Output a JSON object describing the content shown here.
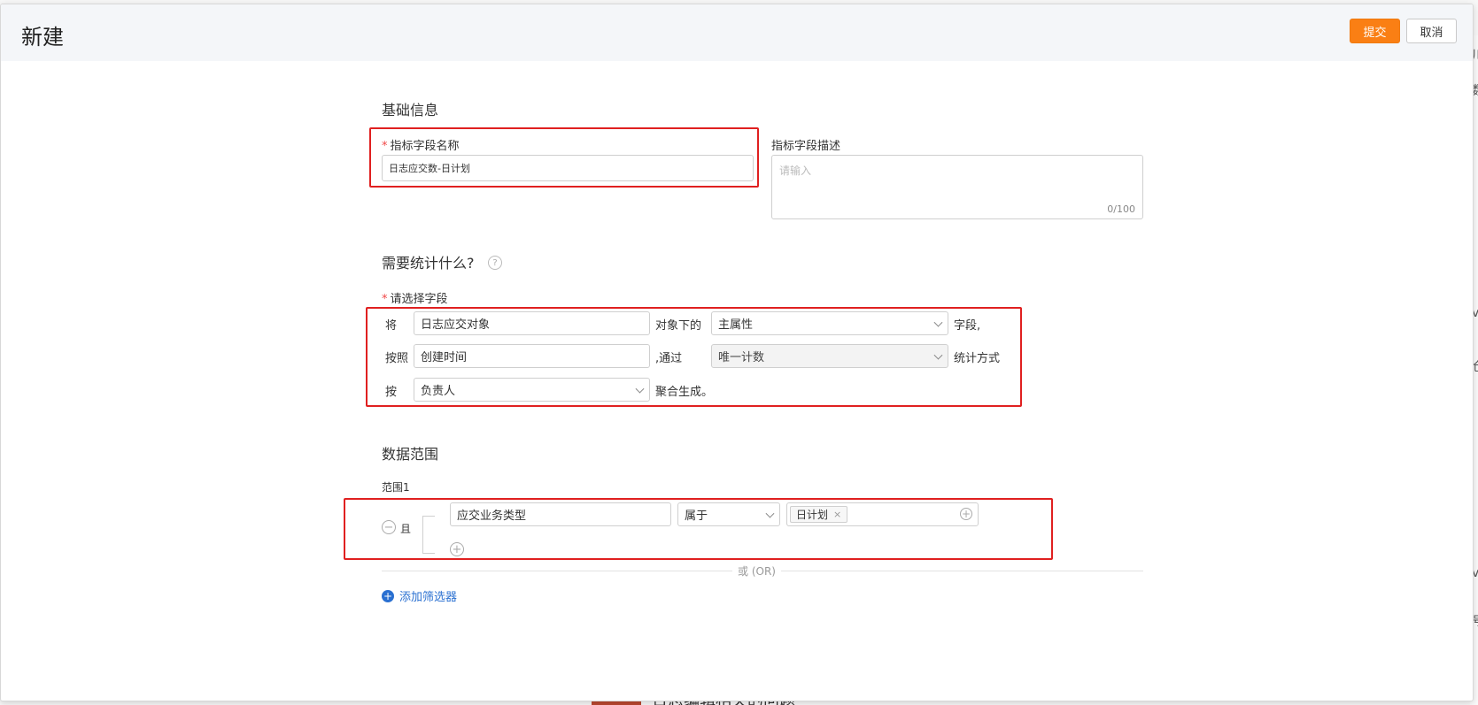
{
  "dialog": {
    "title": "新建",
    "submit_label": "提交",
    "cancel_label": "取消"
  },
  "basic_info": {
    "section_title": "基础信息",
    "name_label": "指标字段名称",
    "name_required_mark": "*",
    "name_value": "日志应交数-日计划",
    "desc_label": "指标字段描述",
    "desc_placeholder": "请输入",
    "desc_counter": "0/100"
  },
  "stats": {
    "section_title": "需要统计什么?",
    "help_icon": "?",
    "field_label": "请选择字段",
    "field_required_mark": "*",
    "row1": {
      "prefix": "将",
      "object_value": "日志应交对象",
      "middle": "对象下的",
      "attribute_value": "主属性",
      "suffix": "字段,"
    },
    "row2": {
      "prefix": "按照",
      "time_value": "创建时间",
      "middle": ",通过",
      "method_value": "唯一计数",
      "suffix": "统计方式"
    },
    "row3": {
      "prefix": "按",
      "group_value": "负责人",
      "suffix": "聚合生成。"
    }
  },
  "data_range": {
    "section_title": "数据范围",
    "range_label": "范围1",
    "and_label": "且",
    "minus_icon": "−",
    "condition_field": "应交业务类型",
    "condition_operator": "属于",
    "condition_tag": "日计划",
    "tag_remove_icon": "×",
    "add_value_icon": "+",
    "add_condition_icon": "+",
    "or_label": "或 (OR)",
    "add_filter_label": "添加筛选器",
    "add_filter_icon": "+"
  },
  "background": {
    "right_chars": [
      "川",
      "数",
      "v",
      "仓",
      "v",
      "号"
    ],
    "bottom_text": "日志编辑相关的问题"
  },
  "colors": {
    "accent": "#fa7f14",
    "highlight": "#e02020",
    "link": "#2a70d1"
  }
}
